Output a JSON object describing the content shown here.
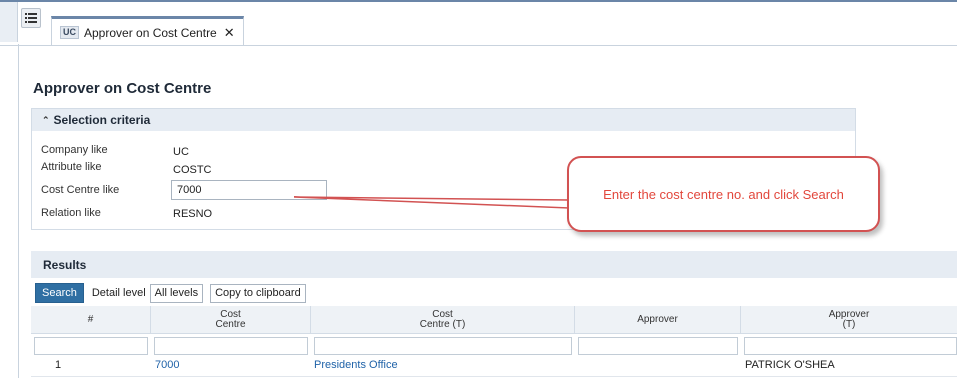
{
  "tab": {
    "badge": "UC",
    "title": "Approver on Cost Centre",
    "close": "✕"
  },
  "page": {
    "title": "Approver on Cost Centre"
  },
  "criteria": {
    "header": "Selection criteria",
    "rows": [
      {
        "label": "Company like",
        "value": "UC"
      },
      {
        "label": "Attribute like",
        "value": "COSTC"
      },
      {
        "label": "Cost Centre like",
        "value": "7000"
      },
      {
        "label": "Relation like",
        "value": "RESNO"
      }
    ]
  },
  "callout": {
    "text": "Enter the cost centre no. and click Search"
  },
  "results": {
    "header": "Results",
    "toolbar": {
      "search": "Search",
      "detail_label": "Detail level",
      "all_levels": "All levels",
      "copy": "Copy to clipboard"
    },
    "columns": [
      {
        "line1": "#",
        "line2": ""
      },
      {
        "line1": "Cost",
        "line2": "Centre"
      },
      {
        "line1": "Cost",
        "line2": "Centre (T)"
      },
      {
        "line1": "Approver",
        "line2": ""
      },
      {
        "line1": "Approver",
        "line2": "(T)"
      }
    ],
    "rows": [
      {
        "num": "1",
        "cost_centre": "7000",
        "cost_centre_t": "Presidents Office",
        "approver": "",
        "approver_t": "PATRICK O'SHEA"
      }
    ]
  }
}
